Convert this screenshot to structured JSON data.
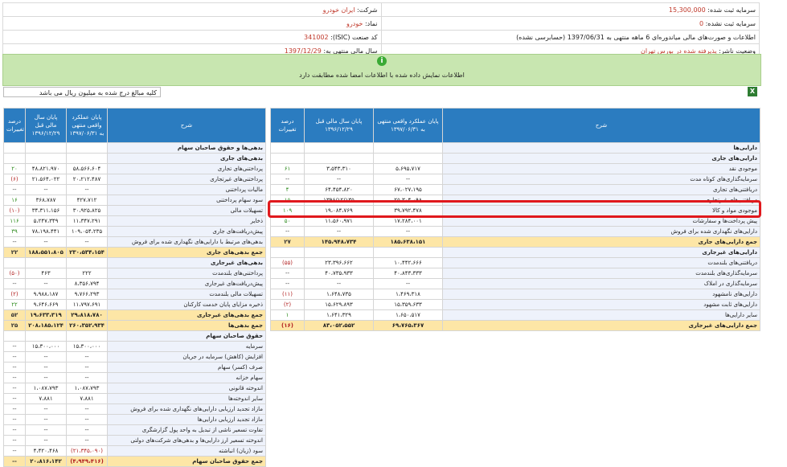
{
  "header": {
    "company_label": "شرکت:",
    "company_value": "ایران خودرو",
    "capital_reg_label": "سرمایه ثبت شده:",
    "capital_reg_value": "15,300,000",
    "symbol_label": "نماد:",
    "symbol_value": "خودرو",
    "capital_unreg_label": "سرمایه ثبت نشده:",
    "capital_unreg_value": "0",
    "isic_label": "کد صنعت (ISIC):",
    "isic_value": "341002",
    "report_title": "اطلاعات و صورت‌های مالی میاندوره‌ای 6 ماهه منتهی به 1397/06/31 (حسابرسی نشده)",
    "fiscal_label": "سال مالی منتهی به:",
    "fiscal_value": "1397/12/29",
    "status_label": "وضعیت ناشر:",
    "status_value": "پذیرفته شده در بورس تهران"
  },
  "notice": {
    "message": "اطلاعات نمایش داده شده با اطلاعات امضا شده مطابقت دارد"
  },
  "units_note": "کلیه مبالغ درج شده به میلیون ریال می باشد",
  "columns": {
    "desc": "شرح",
    "actual": "پایان عملکرد واقعی منتهی به ۱۳۹۷/۰۶/۳۱",
    "prev": "پایان سال مالی قبل ۱۳۹۶/۱۲/۲۹",
    "change": "درصد تغییرات"
  },
  "assets": [
    {
      "name": "دارایی‌ها",
      "a": "",
      "b": "",
      "c": "",
      "kind": "grp"
    },
    {
      "name": "دارایی‌های جاری",
      "a": "",
      "b": "",
      "c": "",
      "kind": "grp"
    },
    {
      "name": "موجودی نقد",
      "a": "۵،۶۹۵،۷۱۷",
      "b": "۳،۵۴۳،۳۱۰",
      "c": "۶۱",
      "kind": "row"
    },
    {
      "name": "سرمایه‌گذاری‌های کوتاه مدت",
      "a": "--",
      "b": "--",
      "c": "--",
      "kind": "row"
    },
    {
      "name": "دریافتنی‌های تجاری",
      "a": "۶۷،۰۲۷،۱۹۵",
      "b": "۶۴،۴۵۴،۸۲۰",
      "c": "۴",
      "kind": "row"
    },
    {
      "name": "دریافتنی‌های غیرتجاری",
      "a": "۲۵،۳۰۴،۰۹۸",
      "b": "۱۳۹۶/۱۲/۱۳۵",
      "c": "۱۵",
      "kind": "row"
    },
    {
      "name": "موجودی مواد و کالا",
      "a": "۳۹،۷۹۲،۴۷۸",
      "b": "۱۹،۰۸۴،۷۶۹",
      "c": "۱۰۹",
      "kind": "row"
    },
    {
      "name": "پیش پرداخت‌ها و سفارشات",
      "a": "۱۷،۲۸۴،۰۰۱",
      "b": "۱۱،۵۶۰،۹۷۱",
      "c": "۵۰",
      "kind": "row"
    },
    {
      "name": "دارایی‌های نگهداری شده برای فروش",
      "a": "--",
      "b": "--",
      "c": "--",
      "kind": "row"
    },
    {
      "name": "جمع دارایی‌های جاری",
      "a": "۱۸۵،۶۳۸،۱۵۱",
      "b": "۱۴۵،۹۴۸،۷۳۴",
      "c": "۲۷",
      "kind": "total"
    },
    {
      "name": "دارایی‌های غیرجاری",
      "a": "",
      "b": "",
      "c": "",
      "kind": "grp"
    },
    {
      "name": "دریافتنی‌های بلندمدت",
      "a": "۱۰،۴۴۲،۶۶۶",
      "b": "۲۳،۳۹۶،۶۶۲",
      "c": "(۵۵)",
      "kind": "row"
    },
    {
      "name": "سرمایه‌گذاری‌های بلندمدت",
      "a": "۴۰،۸۴۳،۳۳۳",
      "b": "۴۰،۷۳۵،۹۳۳",
      "c": "--",
      "kind": "row"
    },
    {
      "name": "سرمایه‌گذاری در املاک",
      "a": "--",
      "b": "--",
      "c": "--",
      "kind": "row"
    },
    {
      "name": "دارایی‌های نامشهود",
      "a": "۱،۴۶۹،۳۱۸",
      "b": "۱،۶۴۸،۷۳۵",
      "c": "(۱۱)",
      "kind": "row"
    },
    {
      "name": "دارایی‌های ثابت مشهود",
      "a": "۱۵،۳۵۹،۶۳۳",
      "b": "۱۵،۶۲۹،۸۹۳",
      "c": "(۲)",
      "kind": "row"
    },
    {
      "name": "سایر دارایی‌ها",
      "a": "۱،۶۵۰،۵۱۷",
      "b": "۱،۶۴۱،۳۲۹",
      "c": "۱",
      "kind": "row"
    },
    {
      "name": "جمع دارایی‌های غیرجاری",
      "a": "۶۹،۷۶۵،۳۶۷",
      "b": "۸۳،۰۵۲،۵۵۲",
      "c": "(۱۶)",
      "kind": "total"
    }
  ],
  "liabilities": [
    {
      "name": "بدهی‌ها و حقوق صاحبان سهام",
      "a": "",
      "b": "",
      "c": "",
      "kind": "grp"
    },
    {
      "name": "بدهی‌های جاری",
      "a": "",
      "b": "",
      "c": "",
      "kind": "grp"
    },
    {
      "name": "پرداختنی‌های تجاری",
      "a": "۵۸،۵۶۶،۶۰۴",
      "b": "۴۸،۸۲۱،۹۷۰",
      "c": "۲۰",
      "kind": "row"
    },
    {
      "name": "پرداختنی‌های غیرتجاری",
      "a": "۲۰،۲۱۲،۴۸۷",
      "b": "۲۱،۵۶۴،۰۲۲",
      "c": "(۶)",
      "kind": "row"
    },
    {
      "name": "مالیات پرداختنی",
      "a": "--",
      "b": "--",
      "c": "--",
      "kind": "row"
    },
    {
      "name": "سود سهام پرداختنی",
      "a": "۴۲۷،۷۱۲",
      "b": "۳۶۸،۷۸۷",
      "c": "۱۶",
      "kind": "row"
    },
    {
      "name": "تسهیلات مالی",
      "a": "۳۰،۹۲۵،۸۲۵",
      "b": "۳۴،۳۱۱،۱۵۶",
      "c": "(۱۰)",
      "kind": "row"
    },
    {
      "name": "ذخایر",
      "a": "۱۱،۳۴۷،۲۹۱",
      "b": "۵،۲۴۷،۳۴۹",
      "c": "۱۱۶",
      "kind": "row"
    },
    {
      "name": "پیش‌دریافت‌های جاری",
      "a": "۱۰۹،۰۵۴،۲۳۵",
      "b": "۷۸،۱۹۸،۴۴۱",
      "c": "۳۹",
      "kind": "row"
    },
    {
      "name": "بدهی‌های مرتبط با دارایی‌های نگهداری شده برای فروش",
      "a": "--",
      "b": "--",
      "c": "--",
      "kind": "row"
    },
    {
      "name": "جمع بدهی‌های جاری",
      "a": "۲۳۰،۵۳۴،۱۵۴",
      "b": "۱۸۸،۵۵۱،۸۰۵",
      "c": "۲۲",
      "kind": "total"
    },
    {
      "name": "بدهی‌های غیرجاری",
      "a": "",
      "b": "",
      "c": "",
      "kind": "grp"
    },
    {
      "name": "پرداختنی‌های بلندمدت",
      "a": "۲۲۲",
      "b": "۴۶۳",
      "c": "(۵۰)",
      "kind": "row"
    },
    {
      "name": "پیش‌دریافت‌های غیرجاری",
      "a": "۸،۳۵۶،۷۹۴",
      "b": "--",
      "c": "--",
      "kind": "row"
    },
    {
      "name": "تسهیلات مالی بلندمدت",
      "a": "۹،۷۶۶،۲۹۳",
      "b": "۹،۹۸۸،۱۸۷",
      "c": "(۲)",
      "kind": "row"
    },
    {
      "name": "ذخیره مزایای پایان خدمت کارکنان",
      "a": "۱۱،۷۹۷،۶۹۱",
      "b": "۹،۶۴۶،۶۶۹",
      "c": "۲۲",
      "kind": "row"
    },
    {
      "name": "جمع بدهی‌های غیرجاری",
      "a": "۲۹،۸۱۸،۷۸۰",
      "b": "۱۹،۶۳۳،۳۱۹",
      "c": "۵۲",
      "kind": "total"
    },
    {
      "name": "جمع بدهی‌ها",
      "a": "۲۶۰،۳۵۲،۹۳۴",
      "b": "۲۰۸،۱۸۵،۱۲۴",
      "c": "۲۵",
      "kind": "total"
    },
    {
      "name": "حقوق صاحبان سهام",
      "a": "",
      "b": "",
      "c": "",
      "kind": "grp"
    },
    {
      "name": "سرمایه",
      "a": "۱۵،۳۰۰،۰۰۰",
      "b": "۱۵،۳۰۰،۰۰۰",
      "c": "--",
      "kind": "row"
    },
    {
      "name": "افزایش (کاهش) سرمایه در جریان",
      "a": "--",
      "b": "--",
      "c": "--",
      "kind": "row"
    },
    {
      "name": "صرف (کسر) سهام",
      "a": "--",
      "b": "--",
      "c": "--",
      "kind": "row"
    },
    {
      "name": "سهام خزانه",
      "a": "--",
      "b": "--",
      "c": "--",
      "kind": "row"
    },
    {
      "name": "اندوخته قانونی",
      "a": "۱،۰۸۷،۷۹۳",
      "b": "۱،۰۸۷،۷۹۳",
      "c": "--",
      "kind": "row"
    },
    {
      "name": "سایر اندوخته‌ها",
      "a": "۷،۸۸۱",
      "b": "۷،۸۸۱",
      "c": "--",
      "kind": "row"
    },
    {
      "name": "مازاد تجدید ارزیابی دارایی‌های نگهداری شده برای فروش",
      "a": "--",
      "b": "--",
      "c": "--",
      "kind": "row"
    },
    {
      "name": "مازاد تجدید ارزیابی دارایی‌ها",
      "a": "--",
      "b": "--",
      "c": "--",
      "kind": "row"
    },
    {
      "name": "تفاوت تسعیر ناشی از تبدیل به واحد پول گزارشگری",
      "a": "--",
      "b": "--",
      "c": "--",
      "kind": "row"
    },
    {
      "name": "اندوخته تسعیر ارز دارایی‌ها و بدهی‌های شرکت‌های دولتی",
      "a": "--",
      "b": "--",
      "c": "--",
      "kind": "row"
    },
    {
      "name": "سود (زیان) انباشته",
      "a": "(۲۱،۳۴۵،۰۹۰)",
      "b": "۴،۴۲۰،۴۶۸",
      "c": "--",
      "kind": "row"
    },
    {
      "name": "جمع حقوق صاحبان سهام",
      "a": "(۴،۹۴۹،۴۱۶)",
      "b": "۲۰،۸۱۶،۱۴۲",
      "c": "--",
      "kind": "total"
    }
  ]
}
